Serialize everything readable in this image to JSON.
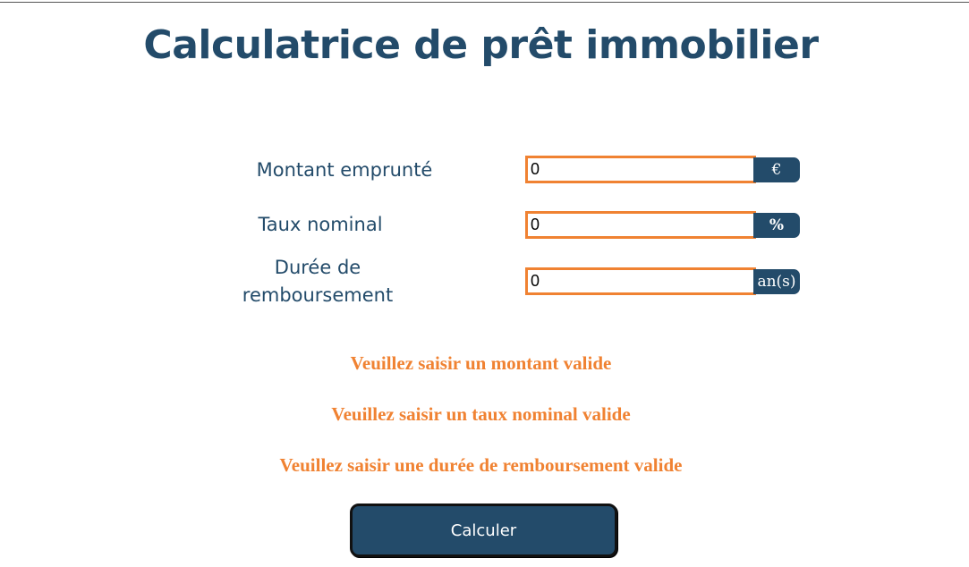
{
  "page": {
    "title": "Calculatrice de prêt immobilier"
  },
  "form": {
    "fields": [
      {
        "label": "Montant emprunté",
        "value": "0",
        "unit": "€"
      },
      {
        "label": "Taux nominal",
        "value": "0",
        "unit": "%"
      },
      {
        "label_line1": "Durée de",
        "label_line2": "remboursement",
        "value": "0",
        "unit": "an(s)"
      }
    ]
  },
  "errors": [
    "Veuillez saisir un montant valide",
    "Veuillez saisir un taux nominal valide",
    "Veuillez saisir une durée de remboursement valide"
  ],
  "actions": {
    "calculate_label": "Calculer"
  },
  "colors": {
    "primary": "#234b6a",
    "accent": "#f08232",
    "background": "#ffffff"
  }
}
